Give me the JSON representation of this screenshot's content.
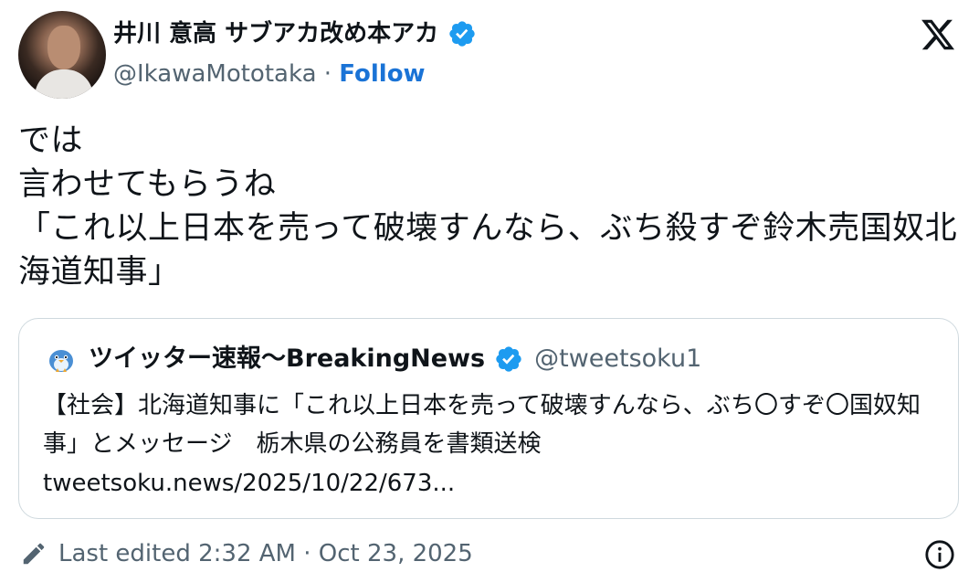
{
  "author": {
    "name": "井川 意高 サブアカ改め本アカ",
    "handle": "@IkawaMototaka",
    "separator": " · ",
    "follow_label": "Follow",
    "verified_icon": "verified-badge-icon",
    "avatar_icon": "avatar"
  },
  "platform": {
    "logo_icon": "x-logo-icon"
  },
  "tweet": {
    "text": "では\n言わせてもらうね\n「これ以上日本を売って破壊すんなら、ぶち殺すぞ鈴木売国奴北海道知事」"
  },
  "quote": {
    "name": "ツイッター速報〜BreakingNews",
    "handle": "@tweetsoku1",
    "text": "【社会】北海道知事に「これ以上日本を売って破壊すんなら、ぶち〇すぞ〇国奴知事」とメッセージ　栃木県の公務員を書類送検",
    "link": "tweetsoku.news/2025/10/22/673..."
  },
  "footer": {
    "edited_label": "Last edited 2:32 AM · Oct 23, 2025",
    "info_icon": "info-icon"
  },
  "colors": {
    "accent": "#1d9bf0",
    "text": "#0f1419",
    "secondary_text": "#536471",
    "border": "#cfd9de"
  }
}
